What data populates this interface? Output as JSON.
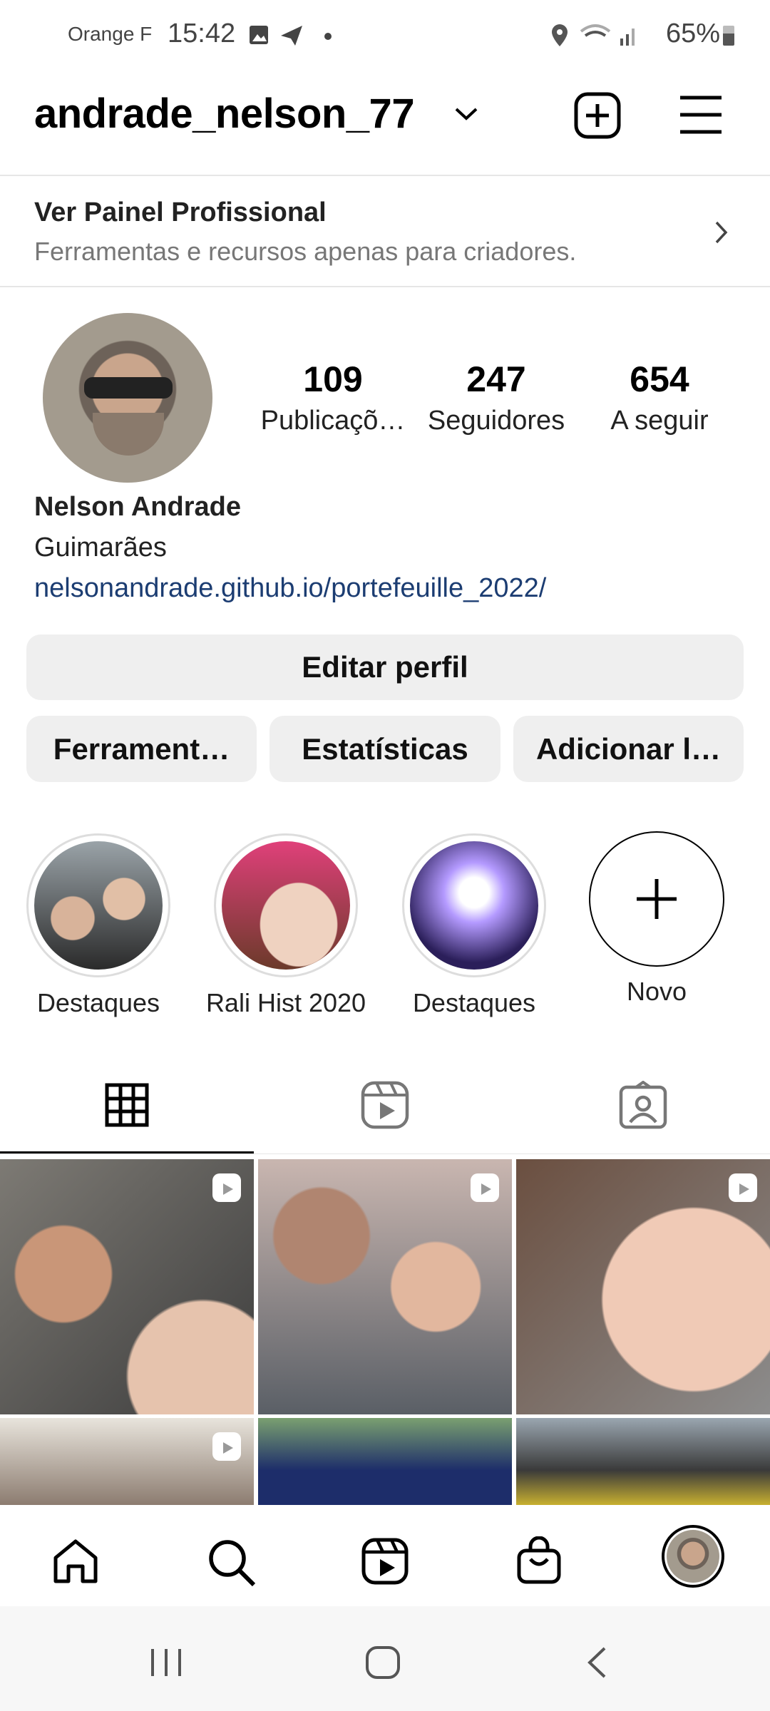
{
  "status_bar": {
    "carrier": "Orange F",
    "time": "15:42",
    "battery": "65%",
    "icons": [
      "gallery-icon",
      "telegram-icon",
      "dot-icon",
      "location-icon",
      "wifi-icon",
      "signal-icon",
      "battery-icon"
    ]
  },
  "header": {
    "username": "andrade_nelson_77",
    "icons": [
      "chevron-down-icon",
      "add-post-icon",
      "menu-icon"
    ]
  },
  "pro_panel": {
    "title": "Ver Painel Profissional",
    "subtitle": "Ferramentas e recursos apenas para criadores."
  },
  "profile": {
    "stats": [
      {
        "value": "109",
        "label": "Publicaçõ…"
      },
      {
        "value": "247",
        "label": "Seguidores"
      },
      {
        "value": "654",
        "label": "A seguir"
      }
    ],
    "name": "Nelson Andrade",
    "city": "Guimarães",
    "link": "nelsonandrade.github.io/portefeuille_2022/"
  },
  "buttons": {
    "edit": "Editar perfil",
    "tools": "Ferrament…",
    "stats": "Estatísticas",
    "add": "Adicionar l…"
  },
  "highlights": [
    {
      "label": "Destaques"
    },
    {
      "label": "Rali Hist 2020"
    },
    {
      "label": "Destaques"
    },
    {
      "label": "Novo"
    }
  ],
  "tabs": [
    {
      "name": "grid",
      "active": true
    },
    {
      "name": "reels",
      "active": false
    },
    {
      "name": "tagged",
      "active": false
    }
  ],
  "colors": {
    "link": "#1c3d72",
    "button_bg": "#efefef"
  }
}
